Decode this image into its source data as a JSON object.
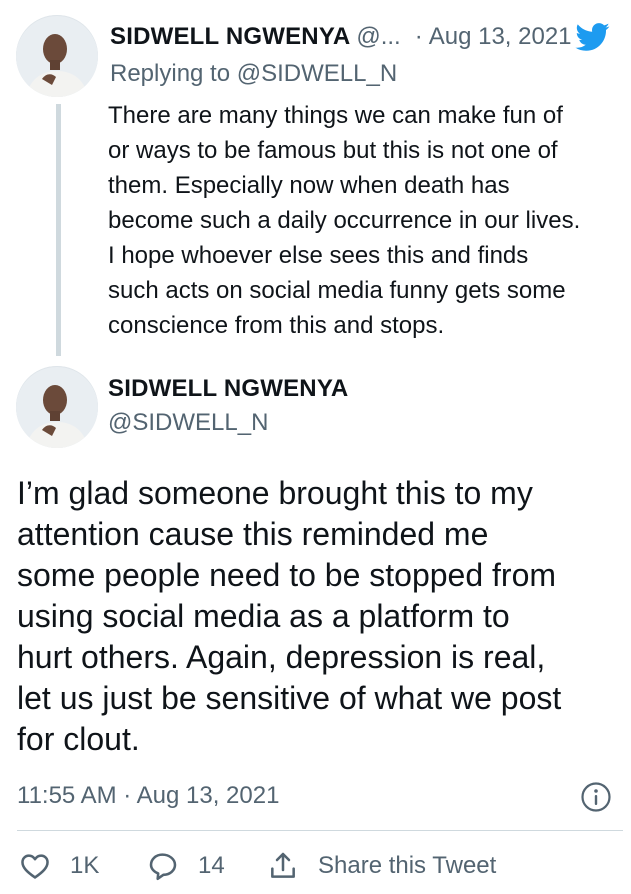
{
  "reply_tweet": {
    "author_name": "SIDWELL NGWENYA",
    "author_handle": "@...",
    "separator": "·",
    "date": "Aug 13, 2021",
    "replying_prefix": "Replying to",
    "replying_handle": "@SIDWELL_N",
    "lines": [
      "There are many things we can make fun of",
      "or ways to be famous but this is not one of",
      "them. Especially now when death has",
      "become such a daily occurrence in our lives.",
      "I hope whoever else sees this and finds",
      "such acts on social media funny gets some",
      "conscience from this and stops."
    ]
  },
  "main_tweet": {
    "author_name": "SIDWELL NGWENYA",
    "author_handle": "@SIDWELL_N",
    "lines": [
      "I’m glad someone brought this to my",
      "attention cause this reminded me",
      "some people need to be stopped from",
      "using social media as a platform to",
      "hurt others. Again, depression is real,",
      "let us just be sensitive of what we post",
      "for clout."
    ],
    "timestamp": "11:55 AM · Aug 13, 2021"
  },
  "actions": {
    "like_count": "1K",
    "reply_count": "14",
    "share_label": "Share this Tweet"
  },
  "colors": {
    "twitter_blue": "#1d9bf0",
    "secondary_text": "#536471",
    "primary_text": "#0f1419",
    "divider": "#cfd9de"
  },
  "icons": [
    "twitter-bird-icon",
    "info-icon",
    "heart-icon",
    "reply-bubble-icon",
    "share-icon"
  ]
}
